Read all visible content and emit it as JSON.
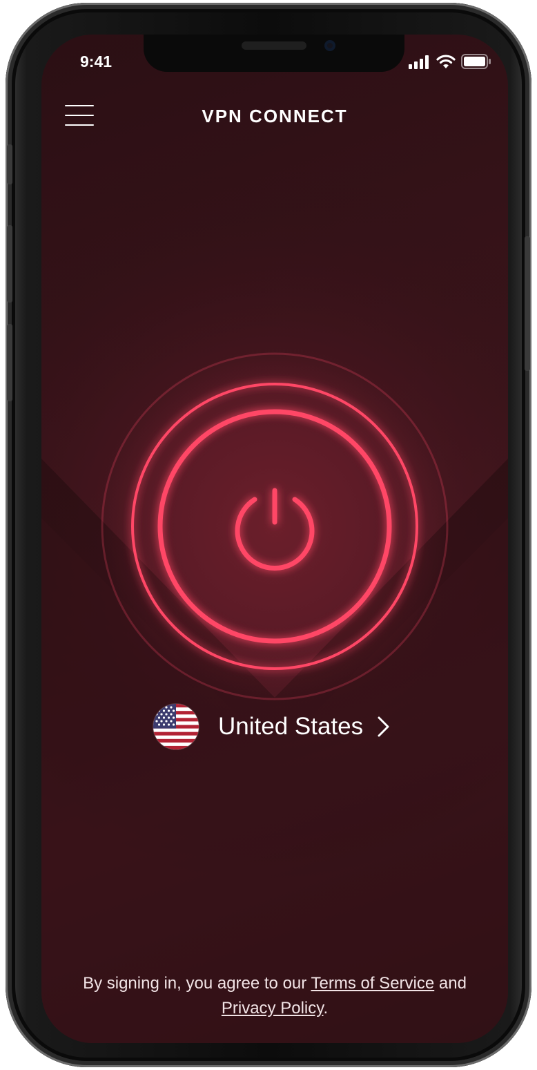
{
  "status_bar": {
    "time": "9:41",
    "icons": [
      "signal-icon",
      "wifi-icon",
      "battery-icon"
    ]
  },
  "header": {
    "title": "VPN CONNECT",
    "menu_icon": "hamburger-menu-icon"
  },
  "power": {
    "icon": "power-icon",
    "accent_color": "#ff4766"
  },
  "location": {
    "country": "United States",
    "flag_icon": "us-flag-icon",
    "chevron_icon": "chevron-right-icon"
  },
  "legal": {
    "prefix": "By signing in, you agree to our ",
    "terms_link": "Terms of Service",
    "middle": " and ",
    "privacy_link": "Privacy Policy",
    "suffix": "."
  },
  "colors": {
    "background_top": "#2b0f14",
    "background_glow": "#5a1a24",
    "accent": "#ff4766",
    "text": "#ffffff"
  }
}
